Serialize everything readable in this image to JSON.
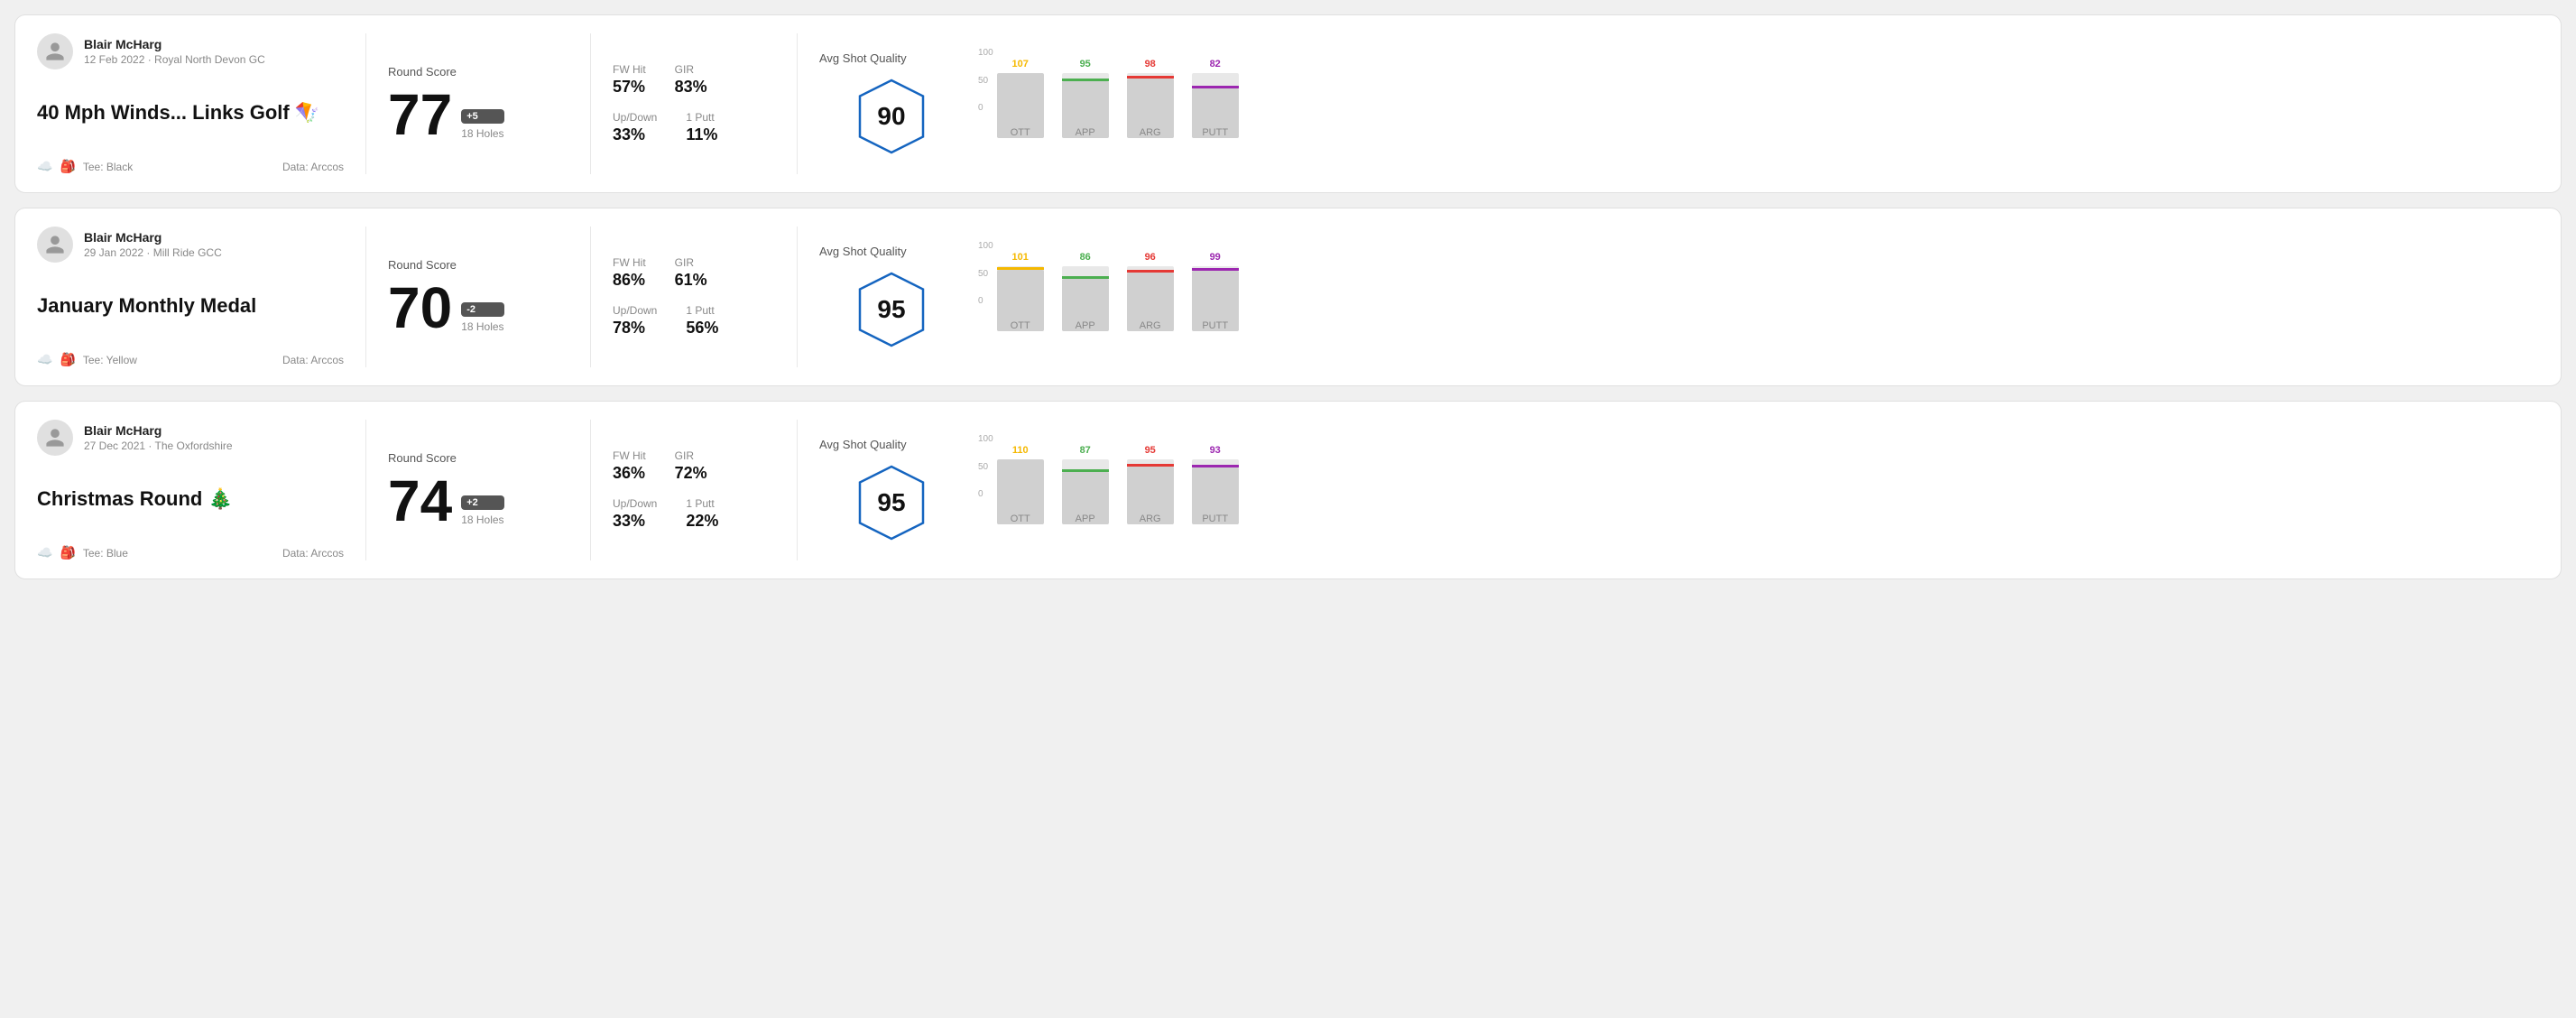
{
  "rounds": [
    {
      "id": "round-1",
      "userName": "Blair McHarg",
      "userDate": "12 Feb 2022 · Royal North Devon GC",
      "title": "40 Mph Winds... Links Golf 🪁",
      "tee": "Tee: Black",
      "dataSource": "Data: Arccos",
      "roundScore": {
        "label": "Round Score",
        "score": "77",
        "badge": "+5",
        "holes": "18 Holes"
      },
      "stats": {
        "fwHit": {
          "label": "FW Hit",
          "value": "57%"
        },
        "gir": {
          "label": "GIR",
          "value": "83%"
        },
        "upDown": {
          "label": "Up/Down",
          "value": "33%"
        },
        "onePutt": {
          "label": "1 Putt",
          "value": "11%"
        }
      },
      "avgShotQuality": {
        "label": "Avg Shot Quality",
        "score": "90"
      },
      "chart": {
        "bars": [
          {
            "label": "OTT",
            "value": 107,
            "color": "#f5b800",
            "maxHeight": 72,
            "fillHeight": 72
          },
          {
            "label": "APP",
            "value": 95,
            "color": "#4caf50",
            "maxHeight": 72,
            "fillHeight": 63
          },
          {
            "label": "ARG",
            "value": 98,
            "color": "#e53935",
            "maxHeight": 72,
            "fillHeight": 66
          },
          {
            "label": "PUTT",
            "value": 82,
            "color": "#9c27b0",
            "maxHeight": 72,
            "fillHeight": 55
          }
        ],
        "yLabels": [
          "100",
          "50",
          "0"
        ]
      }
    },
    {
      "id": "round-2",
      "userName": "Blair McHarg",
      "userDate": "29 Jan 2022 · Mill Ride GCC",
      "title": "January Monthly Medal",
      "tee": "Tee: Yellow",
      "dataSource": "Data: Arccos",
      "roundScore": {
        "label": "Round Score",
        "score": "70",
        "badge": "-2",
        "holes": "18 Holes"
      },
      "stats": {
        "fwHit": {
          "label": "FW Hit",
          "value": "86%"
        },
        "gir": {
          "label": "GIR",
          "value": "61%"
        },
        "upDown": {
          "label": "Up/Down",
          "value": "78%"
        },
        "onePutt": {
          "label": "1 Putt",
          "value": "56%"
        }
      },
      "avgShotQuality": {
        "label": "Avg Shot Quality",
        "score": "95"
      },
      "chart": {
        "bars": [
          {
            "label": "OTT",
            "value": 101,
            "color": "#f5b800",
            "maxHeight": 72,
            "fillHeight": 68
          },
          {
            "label": "APP",
            "value": 86,
            "color": "#4caf50",
            "maxHeight": 72,
            "fillHeight": 58
          },
          {
            "label": "ARG",
            "value": 96,
            "color": "#e53935",
            "maxHeight": 72,
            "fillHeight": 65
          },
          {
            "label": "PUTT",
            "value": 99,
            "color": "#9c27b0",
            "maxHeight": 72,
            "fillHeight": 67
          }
        ],
        "yLabels": [
          "100",
          "50",
          "0"
        ]
      }
    },
    {
      "id": "round-3",
      "userName": "Blair McHarg",
      "userDate": "27 Dec 2021 · The Oxfordshire",
      "title": "Christmas Round 🎄",
      "tee": "Tee: Blue",
      "dataSource": "Data: Arccos",
      "roundScore": {
        "label": "Round Score",
        "score": "74",
        "badge": "+2",
        "holes": "18 Holes"
      },
      "stats": {
        "fwHit": {
          "label": "FW Hit",
          "value": "36%"
        },
        "gir": {
          "label": "GIR",
          "value": "72%"
        },
        "upDown": {
          "label": "Up/Down",
          "value": "33%"
        },
        "onePutt": {
          "label": "1 Putt",
          "value": "22%"
        }
      },
      "avgShotQuality": {
        "label": "Avg Shot Quality",
        "score": "95"
      },
      "chart": {
        "bars": [
          {
            "label": "OTT",
            "value": 110,
            "color": "#f5b800",
            "maxHeight": 72,
            "fillHeight": 72
          },
          {
            "label": "APP",
            "value": 87,
            "color": "#4caf50",
            "maxHeight": 72,
            "fillHeight": 58
          },
          {
            "label": "ARG",
            "value": 95,
            "color": "#e53935",
            "maxHeight": 72,
            "fillHeight": 64
          },
          {
            "label": "PUTT",
            "value": 93,
            "color": "#9c27b0",
            "maxHeight": 72,
            "fillHeight": 63
          }
        ],
        "yLabels": [
          "100",
          "50",
          "0"
        ]
      }
    }
  ]
}
